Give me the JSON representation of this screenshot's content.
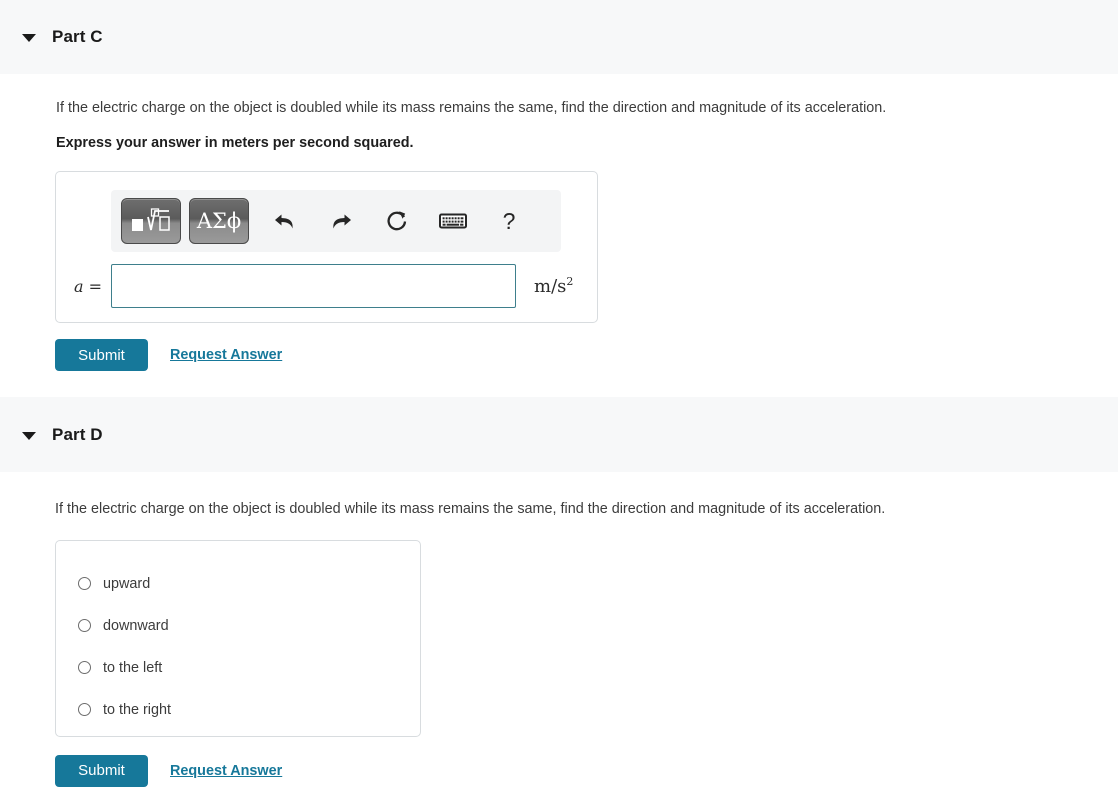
{
  "parts": [
    {
      "id": "part-c",
      "title": "Part C",
      "caret": "caret-down-icon",
      "question": "If the electric charge on the object is doubled while its mass remains the same, find the direction and magnitude of its acceleration.",
      "instruction": "Express your answer in meters per second squared.",
      "answer": {
        "variable": "a",
        "equals": "=",
        "value": "",
        "placeholder": "",
        "units": "m/s",
        "units_exponent": "2",
        "input_border_color": "#3e7f8c"
      },
      "toolbar": {
        "buttons": [
          {
            "name": "math-template-button",
            "label": "",
            "kind": "template"
          },
          {
            "name": "greek-symbols-button",
            "label": "ΑΣϕ",
            "kind": "greek"
          }
        ],
        "icons": [
          {
            "name": "undo-icon",
            "title": "undo"
          },
          {
            "name": "redo-icon",
            "title": "redo"
          },
          {
            "name": "reset-icon",
            "title": "reset"
          },
          {
            "name": "keyboard-icon",
            "title": "keyboard shortcuts"
          },
          {
            "name": "help-icon",
            "title": "help",
            "glyph": "?"
          }
        ]
      },
      "submit_label": "Submit",
      "request_answer_label": "Request Answer"
    },
    {
      "id": "part-d",
      "title": "Part D",
      "caret": "caret-down-icon",
      "question": "If the electric charge on the object is doubled while its mass remains the same, find the direction and magnitude of its acceleration.",
      "options": [
        {
          "label": "upward",
          "selected": false
        },
        {
          "label": "downward",
          "selected": false
        },
        {
          "label": "to the left",
          "selected": false
        },
        {
          "label": "to the right",
          "selected": false
        }
      ],
      "submit_label": "Submit",
      "request_answer_label": "Request Answer"
    }
  ],
  "theme": {
    "accent": "#16789a",
    "header_background": "#f7f8f9",
    "border": "#d8dcdf",
    "text": "#3c3c3c"
  }
}
